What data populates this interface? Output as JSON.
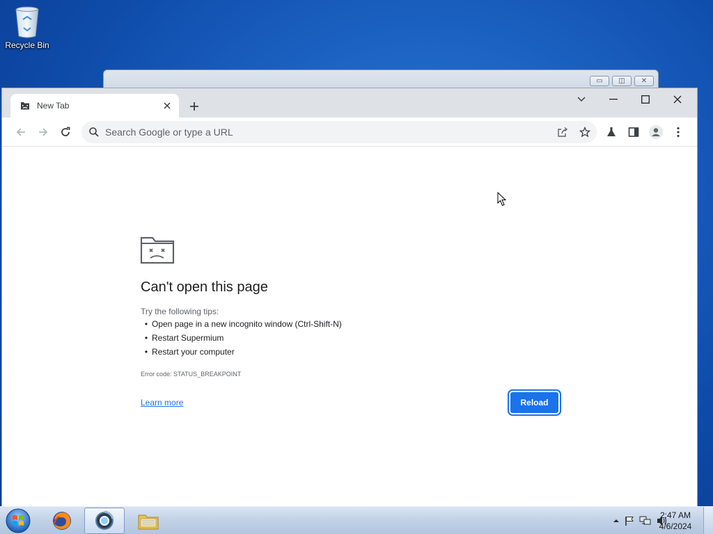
{
  "desktop": {
    "icons": [
      {
        "label": "Recycle Bin",
        "icon": "recycle-bin-icon"
      }
    ]
  },
  "browser": {
    "tab": {
      "title": "New Tab",
      "icon": "sad-folder-icon"
    },
    "omnibox": {
      "placeholder": "Search Google or type a URL",
      "value": ""
    },
    "toolbar_icons": [
      "back-arrow-icon",
      "forward-arrow-icon",
      "reload-icon",
      "share-icon",
      "star-icon",
      "labs-flask-icon",
      "side-panel-icon",
      "profile-icon",
      "menu-icon"
    ],
    "window_controls": [
      "tab-search-icon",
      "minimize-icon",
      "maximize-icon",
      "close-icon"
    ]
  },
  "error_page": {
    "title": "Can't open this page",
    "tips_heading": "Try the following tips:",
    "tips": [
      "Open page in a new incognito window (Ctrl-Shift-N)",
      "Restart Supermium",
      "Restart your computer"
    ],
    "error_code": "Error code: STATUS_BREAKPOINT",
    "learn_more": "Learn more",
    "reload_label": "Reload"
  },
  "taskbar": {
    "items": [
      "start-orb-icon",
      "firefox-icon",
      "supermium-icon",
      "file-explorer-icon"
    ],
    "tray_icons": [
      "tray-expand-icon",
      "action-center-flag-icon",
      "network-icon",
      "volume-icon"
    ],
    "time": "2:47 AM",
    "date": "4/6/2024"
  },
  "colors": {
    "accent": "#1a73e8",
    "tabstrip": "#dee1e6",
    "link": "#1a73e8"
  }
}
